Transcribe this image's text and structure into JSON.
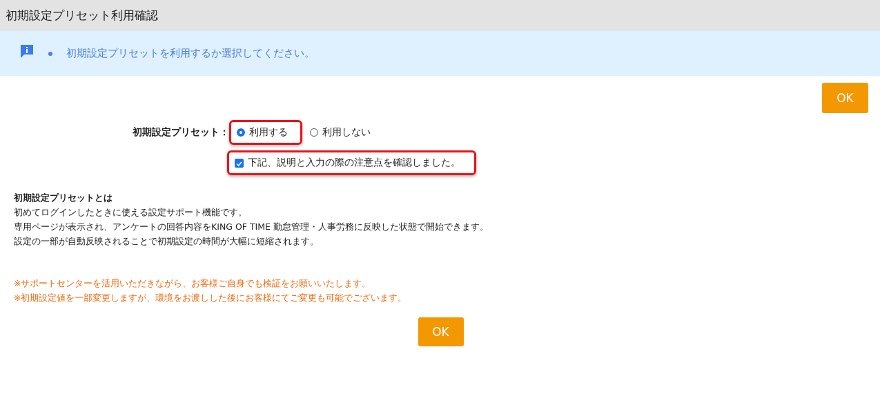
{
  "window": {
    "title": "初期設定プリセット利用確認"
  },
  "info": {
    "messages": [
      "初期設定プリセットを利用するか選択してください。"
    ]
  },
  "top_button": "OK",
  "preset": {
    "label": "初期設定プリセット：",
    "options": [
      {
        "label": "利用する",
        "selected": true,
        "highlighted": true
      },
      {
        "label": "利用しない",
        "selected": false,
        "highlighted": false
      }
    ]
  },
  "confirm": {
    "label": "下記、説明と入力の際の注意点を確認しました。",
    "checked": true,
    "highlighted": true
  },
  "description": {
    "heading": "初期設定プリセットとは",
    "lines": [
      "初めてログインしたときに使える設定サポート機能です。",
      "専用ページが表示され、アンケートの回答内容をKING OF TIME 勤怠管理・人事労務に反映した状態で開始できます。",
      "設定の一部が自動反映されることで初期設定の時間が大幅に短縮されます。"
    ]
  },
  "notes": [
    "※サポートセンターを活用いただきながら、お客様ご自身でも検証をお願いいたします。",
    "※初期設定値を一部変更しますが、環境をお渡しした後にお客様にてご変更も可能でございます。"
  ],
  "bottom_button": "OK"
}
